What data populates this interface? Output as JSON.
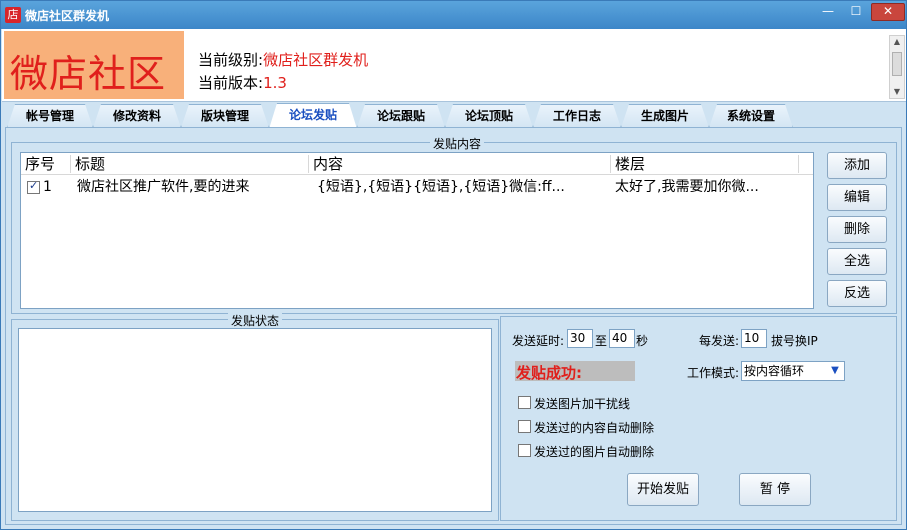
{
  "window": {
    "title": "微店社区群发机",
    "icon_char": "店",
    "min": "—",
    "max": "☐",
    "close": "✕"
  },
  "header": {
    "logo": "微店社区",
    "level_label": "当前级别:",
    "level_value": "微店社区群发机",
    "version_label": "当前版本:",
    "version_value": "1.3"
  },
  "tabs": [
    "帐号管理",
    "修改资料",
    "版块管理",
    "论坛发贴",
    "论坛跟贴",
    "论坛顶贴",
    "工作日志",
    "生成图片",
    "系统设置"
  ],
  "post_content": {
    "group_title": "发贴内容",
    "columns": [
      "序号",
      "标题",
      "内容",
      "楼层"
    ],
    "rows": [
      {
        "checked": true,
        "index": "1",
        "title": "微店社区推广软件,要的进来",
        "content": "{短语},{短语}{短语},{短语}微信:ff...",
        "floor": "太好了,我需要加你微..."
      }
    ]
  },
  "side_buttons": [
    "添加",
    "编辑",
    "删除",
    "全选",
    "反选"
  ],
  "post_status": {
    "group_title": "发贴状态"
  },
  "settings": {
    "delay_label": "发送延时:",
    "delay_min": "30",
    "delay_to": "至",
    "delay_max": "40",
    "delay_unit": "秒",
    "per_send_label": "每发送:",
    "per_send_value": "10",
    "per_send_suffix": "拔号换IP",
    "success_text": "发贴成功:",
    "work_mode_label": "工作模式:",
    "work_mode_value": "按内容循环",
    "options": [
      {
        "label": "发送图片加干扰线",
        "checked": false
      },
      {
        "label": "发送过的内容自动删除",
        "checked": false
      },
      {
        "label": "发送过的图片自动删除",
        "checked": false
      }
    ],
    "start_button": "开始发贴",
    "pause_button": "暂 停"
  },
  "colors": {
    "accent_red": "#e0201c",
    "logo_bg": "#f8b07a",
    "active_tab_text": "#1a4fc0",
    "panel_bg": "#cfe3f2"
  }
}
